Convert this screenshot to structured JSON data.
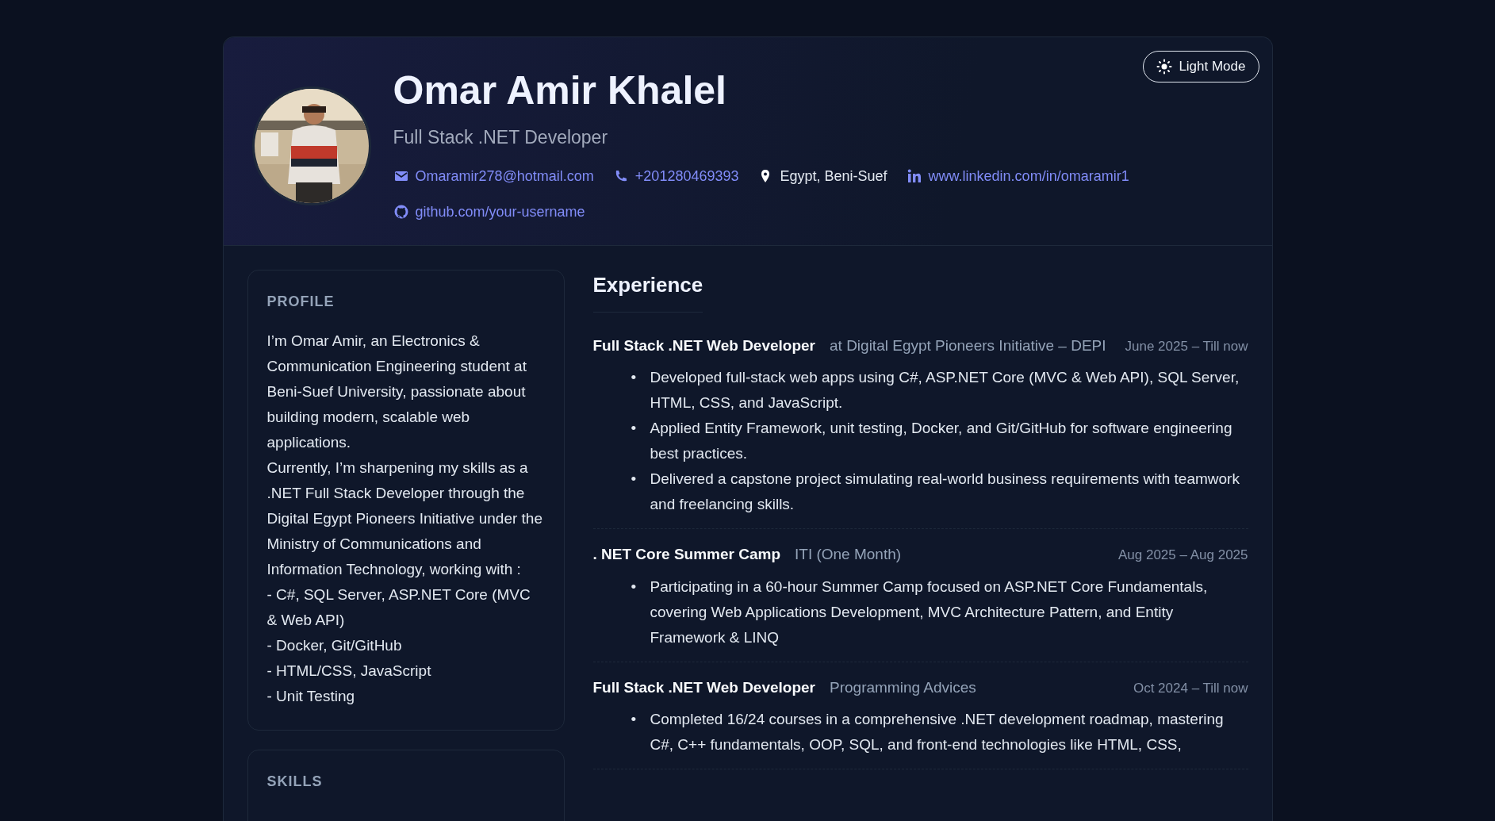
{
  "header": {
    "name": "Omar Amir Khalel",
    "subtitle": "Full Stack .NET Developer",
    "theme_button": {
      "label": "Light Mode"
    },
    "contacts": [
      {
        "kind": "email",
        "text": "Omaramir278@hotmail.com",
        "link": true
      },
      {
        "kind": "phone",
        "text": "+201280469393",
        "link": true
      },
      {
        "kind": "location",
        "text": "Egypt, Beni-Suef",
        "link": false
      },
      {
        "kind": "linkedin",
        "text": "www.linkedin.com/in/omaramir1",
        "link": true
      },
      {
        "kind": "github",
        "text": "github.com/your-username",
        "link": true
      }
    ]
  },
  "profile": {
    "heading": "PROFILE",
    "lines": [
      "I’m Omar Amir, an Electronics & Communication Engineering student at Beni-Suef University, passionate about building modern, scalable web applications.",
      "Currently, I’m sharpening my skills as a .NET Full Stack Developer through the Digital Egypt Pioneers Initiative under the Ministry of Communications and Information Technology, working with :",
      "- C#, SQL Server, ASP.NET Core (MVC & Web API)",
      "- Docker, Git/GitHub",
      "- HTML/CSS, JavaScript",
      "- Unit Testing"
    ]
  },
  "skills": {
    "heading": "SKILLS"
  },
  "experience": {
    "heading": "Experience",
    "bullet_marker": "•",
    "items": [
      {
        "title": "Full Stack .NET Web Developer",
        "org": "at Digital Egypt Pioneers Initiative – DEPI",
        "date": "June 2025 – Till now",
        "bullets": [
          "Developed full-stack web apps using C#, ASP.NET Core (MVC & Web API), SQL Server, HTML, CSS, and JavaScript.",
          "Applied Entity Framework, unit testing, Docker, and Git/GitHub for software engineering best practices.",
          "Delivered a capstone project simulating real-world business requirements with teamwork and freelancing skills."
        ]
      },
      {
        "title": ". NET Core Summer Camp",
        "org": "ITI (One Month)",
        "date": "Aug 2025 – Aug 2025",
        "bullets": [
          "Participating in a 60-hour Summer Camp focused on ASP.NET Core Fundamentals, covering Web Applications Development, MVC Architecture Pattern, and Entity Framework & LINQ"
        ]
      },
      {
        "title": "Full Stack .NET Web Developer",
        "org": "Programming Advices",
        "date": "Oct 2024 – Till now",
        "bullets": [
          "Completed 16/24 courses in a comprehensive .NET development roadmap, mastering C#, C++ fundamentals, OOP, SQL, and front-end technologies like HTML, CSS,"
        ]
      }
    ]
  }
}
